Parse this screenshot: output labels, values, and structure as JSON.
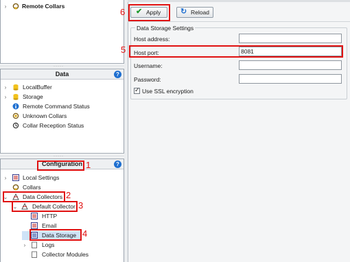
{
  "top_pane": {
    "item": "Remote Collars"
  },
  "data_pane": {
    "title": "Data",
    "items": [
      "LocalBuffer",
      "Storage",
      "Remote Command Status",
      "Unknown Collars",
      "Collar Reception Status"
    ]
  },
  "config_pane": {
    "title": "Configuration",
    "items": [
      "Local Settings",
      "Collars",
      "Data Collectors",
      "Default Collector",
      "HTTP",
      "Email",
      "Data Storage",
      "Logs",
      "Collector Modules"
    ]
  },
  "toolbar": {
    "apply_label": "Apply",
    "reload_label": "Reload"
  },
  "storage_settings": {
    "group_title": "Data Storage Settings",
    "host_address_label": "Host address:",
    "host_address_value": "",
    "host_port_label": "Host port:",
    "host_port_value": "8081",
    "username_label": "Username:",
    "username_value": "",
    "password_label": "Password:",
    "password_value": "",
    "ssl_label": "Use SSL encryption",
    "ssl_checked": true
  },
  "annotations": [
    "1",
    "2",
    "3",
    "4",
    "5",
    "6"
  ],
  "colors": {
    "annotation_red": "#e01010",
    "help_blue": "#1e6fd0"
  }
}
